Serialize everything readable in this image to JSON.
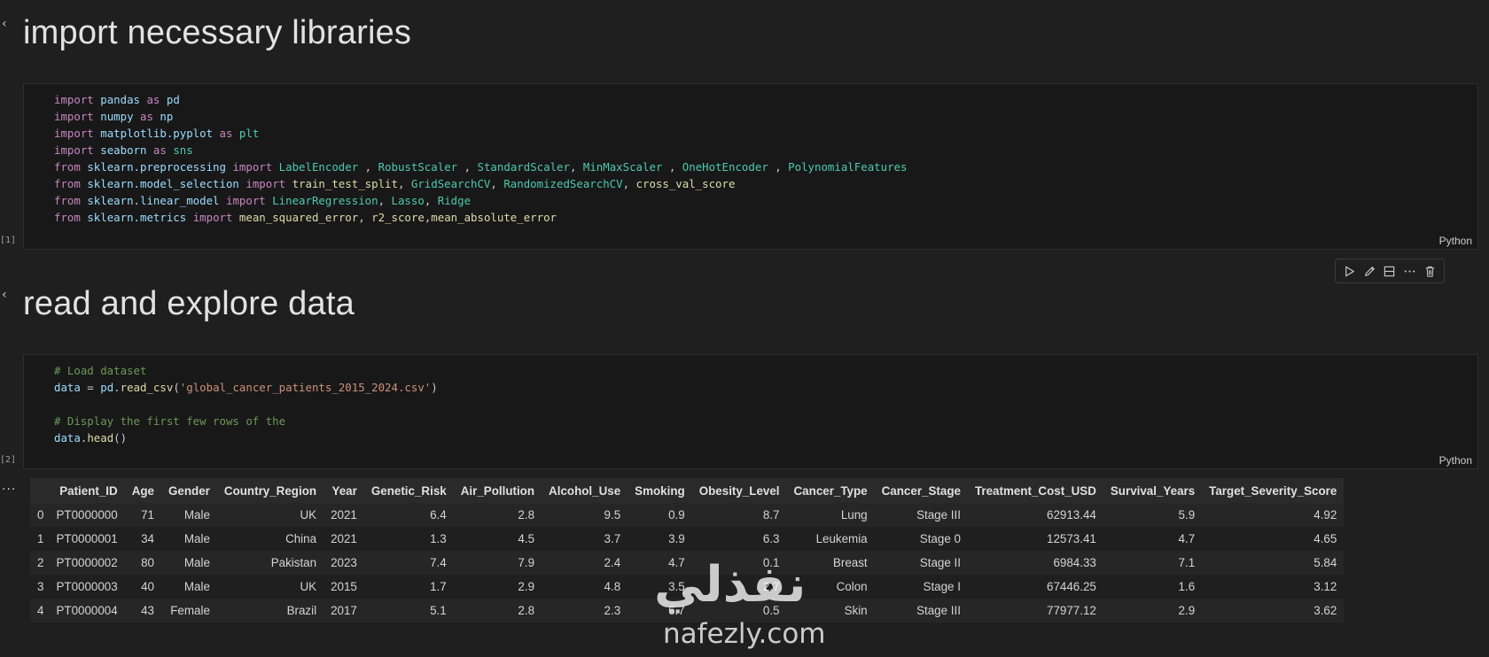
{
  "cells": {
    "md1": {
      "title": "import necessary libraries"
    },
    "code1": {
      "exec_count": "[1]",
      "language": "Python",
      "lines": [
        [
          {
            "t": "import",
            "c": "kw"
          },
          {
            "t": " ",
            "c": "pl"
          },
          {
            "t": "pandas",
            "c": "mod"
          },
          {
            "t": " ",
            "c": "pl"
          },
          {
            "t": "as",
            "c": "kw"
          },
          {
            "t": " ",
            "c": "pl"
          },
          {
            "t": "pd",
            "c": "mod"
          }
        ],
        [
          {
            "t": "import",
            "c": "kw"
          },
          {
            "t": " ",
            "c": "pl"
          },
          {
            "t": "numpy",
            "c": "mod"
          },
          {
            "t": " ",
            "c": "pl"
          },
          {
            "t": "as",
            "c": "kw"
          },
          {
            "t": " ",
            "c": "pl"
          },
          {
            "t": "np",
            "c": "mod"
          }
        ],
        [
          {
            "t": "import",
            "c": "kw"
          },
          {
            "t": " ",
            "c": "pl"
          },
          {
            "t": "matplotlib.pyplot",
            "c": "mod"
          },
          {
            "t": " ",
            "c": "pl"
          },
          {
            "t": "as",
            "c": "kw"
          },
          {
            "t": " ",
            "c": "pl"
          },
          {
            "t": "plt",
            "c": "cls"
          }
        ],
        [
          {
            "t": "import",
            "c": "kw"
          },
          {
            "t": " ",
            "c": "pl"
          },
          {
            "t": "seaborn",
            "c": "mod"
          },
          {
            "t": " ",
            "c": "pl"
          },
          {
            "t": "as",
            "c": "kw"
          },
          {
            "t": " ",
            "c": "pl"
          },
          {
            "t": "sns",
            "c": "cls"
          }
        ],
        [
          {
            "t": "from",
            "c": "kw"
          },
          {
            "t": " ",
            "c": "pl"
          },
          {
            "t": "sklearn.preprocessing",
            "c": "mod"
          },
          {
            "t": " ",
            "c": "pl"
          },
          {
            "t": "import",
            "c": "kw"
          },
          {
            "t": " ",
            "c": "pl"
          },
          {
            "t": "LabelEncoder",
            "c": "cls"
          },
          {
            "t": " , ",
            "c": "pl"
          },
          {
            "t": "RobustScaler",
            "c": "cls"
          },
          {
            "t": " , ",
            "c": "pl"
          },
          {
            "t": "StandardScaler",
            "c": "cls"
          },
          {
            "t": ", ",
            "c": "pl"
          },
          {
            "t": "MinMaxScaler",
            "c": "cls"
          },
          {
            "t": " , ",
            "c": "pl"
          },
          {
            "t": "OneHotEncoder",
            "c": "cls"
          },
          {
            "t": " , ",
            "c": "pl"
          },
          {
            "t": "PolynomialFeatures",
            "c": "cls"
          }
        ],
        [
          {
            "t": "from",
            "c": "kw"
          },
          {
            "t": " ",
            "c": "pl"
          },
          {
            "t": "sklearn.model_selection",
            "c": "mod"
          },
          {
            "t": " ",
            "c": "pl"
          },
          {
            "t": "import",
            "c": "kw"
          },
          {
            "t": " ",
            "c": "pl"
          },
          {
            "t": "train_test_split",
            "c": "fn"
          },
          {
            "t": ", ",
            "c": "pl"
          },
          {
            "t": "GridSearchCV",
            "c": "cls"
          },
          {
            "t": ", ",
            "c": "pl"
          },
          {
            "t": "RandomizedSearchCV",
            "c": "cls"
          },
          {
            "t": ", ",
            "c": "pl"
          },
          {
            "t": "cross_val_score",
            "c": "fn"
          }
        ],
        [
          {
            "t": "from",
            "c": "kw"
          },
          {
            "t": " ",
            "c": "pl"
          },
          {
            "t": "sklearn.linear_model",
            "c": "mod"
          },
          {
            "t": " ",
            "c": "pl"
          },
          {
            "t": "import",
            "c": "kw"
          },
          {
            "t": " ",
            "c": "pl"
          },
          {
            "t": "LinearRegression",
            "c": "cls"
          },
          {
            "t": ", ",
            "c": "pl"
          },
          {
            "t": "Lasso",
            "c": "cls"
          },
          {
            "t": ", ",
            "c": "pl"
          },
          {
            "t": "Ridge",
            "c": "cls"
          }
        ],
        [
          {
            "t": "from",
            "c": "kw"
          },
          {
            "t": " ",
            "c": "pl"
          },
          {
            "t": "sklearn.metrics",
            "c": "mod"
          },
          {
            "t": " ",
            "c": "pl"
          },
          {
            "t": "import",
            "c": "kw"
          },
          {
            "t": " ",
            "c": "pl"
          },
          {
            "t": "mean_squared_error",
            "c": "fn"
          },
          {
            "t": ", ",
            "c": "pl"
          },
          {
            "t": "r2_score",
            "c": "fn"
          },
          {
            "t": ",",
            "c": "pl"
          },
          {
            "t": "mean_absolute_error",
            "c": "fn"
          }
        ]
      ]
    },
    "md2": {
      "title": "read and explore data"
    },
    "code2": {
      "exec_count": "[2]",
      "language": "Python",
      "lines": [
        [
          {
            "t": "# Load dataset",
            "c": "cm"
          }
        ],
        [
          {
            "t": "data",
            "c": "mod"
          },
          {
            "t": " = ",
            "c": "pl"
          },
          {
            "t": "pd",
            "c": "mod"
          },
          {
            "t": ".",
            "c": "pl"
          },
          {
            "t": "read_csv",
            "c": "fn"
          },
          {
            "t": "(",
            "c": "pl"
          },
          {
            "t": "'global_cancer_patients_2015_2024.csv'",
            "c": "str"
          },
          {
            "t": ")",
            "c": "pl"
          }
        ],
        [],
        [
          {
            "t": "# Display the first few rows of the",
            "c": "cm"
          }
        ],
        [
          {
            "t": "data",
            "c": "mod"
          },
          {
            "t": ".",
            "c": "pl"
          },
          {
            "t": "head",
            "c": "fn"
          },
          {
            "t": "()",
            "c": "pl"
          }
        ]
      ]
    }
  },
  "toolbar": {
    "icons": [
      "run-icon",
      "edit-icon",
      "split-icon",
      "more-icon",
      "delete-icon"
    ]
  },
  "output": {
    "more_glyph": "...",
    "columns": [
      "",
      "Patient_ID",
      "Age",
      "Gender",
      "Country_Region",
      "Year",
      "Genetic_Risk",
      "Air_Pollution",
      "Alcohol_Use",
      "Smoking",
      "Obesity_Level",
      "Cancer_Type",
      "Cancer_Stage",
      "Treatment_Cost_USD",
      "Survival_Years",
      "Target_Severity_Score"
    ],
    "rows": [
      [
        "0",
        "PT0000000",
        "71",
        "Male",
        "UK",
        "2021",
        "6.4",
        "2.8",
        "9.5",
        "0.9",
        "8.7",
        "Lung",
        "Stage III",
        "62913.44",
        "5.9",
        "4.92"
      ],
      [
        "1",
        "PT0000001",
        "34",
        "Male",
        "China",
        "2021",
        "1.3",
        "4.5",
        "3.7",
        "3.9",
        "6.3",
        "Leukemia",
        "Stage 0",
        "12573.41",
        "4.7",
        "4.65"
      ],
      [
        "2",
        "PT0000002",
        "80",
        "Male",
        "Pakistan",
        "2023",
        "7.4",
        "7.9",
        "2.4",
        "4.7",
        "0.1",
        "Breast",
        "Stage II",
        "6984.33",
        "7.1",
        "5.84"
      ],
      [
        "3",
        "PT0000003",
        "40",
        "Male",
        "UK",
        "2015",
        "1.7",
        "2.9",
        "4.8",
        "3.5",
        "2.7",
        "Colon",
        "Stage I",
        "67446.25",
        "1.6",
        "3.12"
      ],
      [
        "4",
        "PT0000004",
        "43",
        "Female",
        "Brazil",
        "2017",
        "5.1",
        "2.8",
        "2.3",
        "6.7",
        "0.5",
        "Skin",
        "Stage III",
        "77977.12",
        "2.9",
        "3.62"
      ]
    ]
  },
  "watermark": {
    "arabic": "نفذلي",
    "latin": "nafezly.com"
  }
}
